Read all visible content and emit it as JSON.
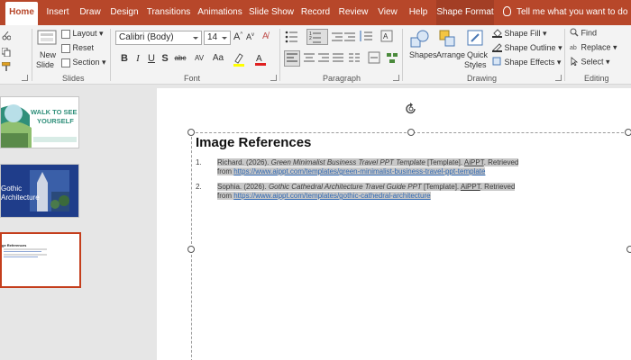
{
  "tabs": [
    "Home",
    "Insert",
    "Draw",
    "Design",
    "Transitions",
    "Animations",
    "Slide Show",
    "Record",
    "Review",
    "View",
    "Help",
    "Shape Format"
  ],
  "active_tab": "Home",
  "tell_me": "Tell me what you want to do",
  "ribbon": {
    "slides": {
      "new_slide_1": "New",
      "new_slide_2": "Slide",
      "layout": "Layout",
      "reset": "Reset",
      "section": "Section",
      "label": "Slides"
    },
    "font": {
      "family": "Calibri (Body)",
      "size": "14",
      "bold": "B",
      "italic": "I",
      "underline": "U",
      "strike": "S",
      "spacing": "abc",
      "spacing2": "AV",
      "case": "Aa",
      "label": "Font"
    },
    "paragraph": {
      "label": "Paragraph"
    },
    "drawing": {
      "shapes": "Shapes",
      "arrange": "Arrange",
      "quick_1": "Quick",
      "quick_2": "Styles",
      "fill": "Shape Fill",
      "outline": "Shape Outline",
      "effects": "Shape Effects",
      "label": "Drawing"
    },
    "editing": {
      "find": "Find",
      "replace": "Replace",
      "select": "Select",
      "label": "Editing"
    }
  },
  "thumbnails": {
    "slide1_text_1": "WALK TO SEE",
    "slide1_text_2": "YOURSELF",
    "slide2_text_1": "Gothic",
    "slide2_text_2": "Architecture",
    "slide3_text": "ge References"
  },
  "slide": {
    "title": "Image References",
    "references": [
      {
        "num": "1.",
        "line1_plain": "Richard. (2026). ",
        "line1_italic": "Green Minimalist Business Travel PPT Template",
        "line1_rest": " [Template]. ",
        "line1_brand": "AiPPT",
        "line1_end": ". Retrieved",
        "line2_prefix": "from ",
        "line2_link": "https://www.aippt.com/templates/green-minimalist-business-travel-ppt-template"
      },
      {
        "num": "2.",
        "line1_plain": "Sophia. (2026). ",
        "line1_italic": "Gothic Cathedral Architecture Travel Guide PPT",
        "line1_rest": " [Template]. ",
        "line1_brand": "AiPPT",
        "line1_end": ". Retrieved",
        "line2_prefix": "from ",
        "line2_link": "https://www.aippt.com/templates/gothic-cathedral-architecture"
      }
    ]
  },
  "colors": {
    "accent": "#b7472a",
    "link": "#2e67b2",
    "selection": "#c43e1c"
  }
}
